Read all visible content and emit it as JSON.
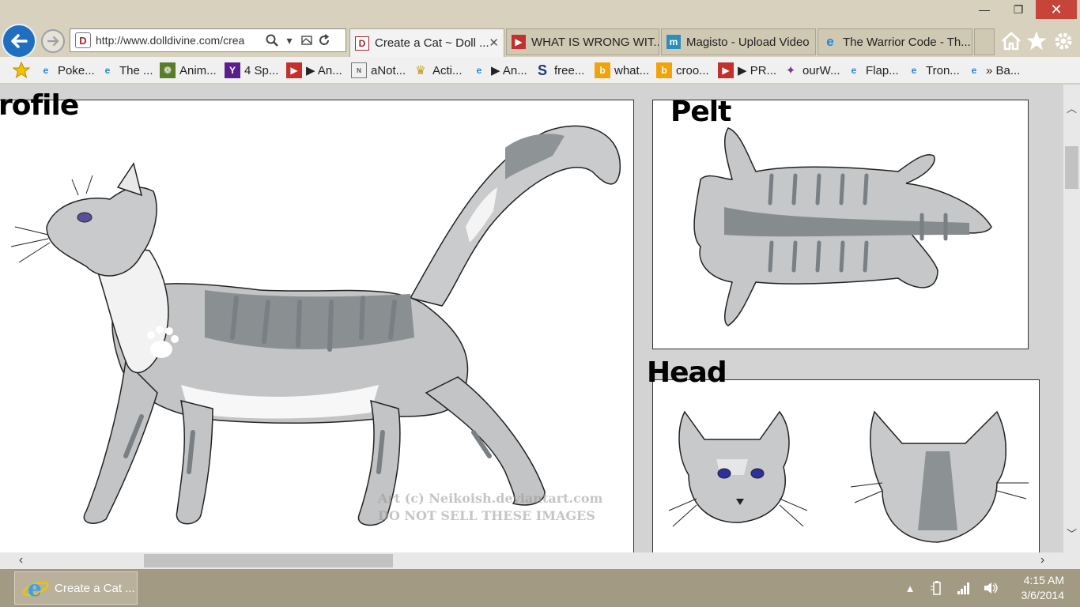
{
  "window": {
    "min_glyph": "—",
    "max_glyph": "❐",
    "close_glyph": "✕"
  },
  "address": {
    "url": "http://www.dolldivine.com/crea"
  },
  "tabs": [
    {
      "label": "Create a Cat ~ Doll ...",
      "icon": "dolldivine-icon",
      "color": "#a0282f",
      "active": true
    },
    {
      "label": "WHAT IS WRONG WIT...",
      "icon": "youtube-icon",
      "color": "#c4302b",
      "active": false
    },
    {
      "label": "Magisto - Upload Video",
      "icon": "magisto-icon",
      "color": "#2c8fb7",
      "active": false
    },
    {
      "label": "The Warrior Code - Th...",
      "icon": "ie-icon",
      "color": "#1e88d8",
      "active": false
    }
  ],
  "toolbar": {
    "home_icon": "home-icon",
    "favorites_icon": "star-icon",
    "settings_icon": "gear-icon"
  },
  "favorites": [
    {
      "label": "Poke...",
      "icon": "ie-icon",
      "color": "#1e88d8"
    },
    {
      "label": "The ...",
      "icon": "ie-icon",
      "color": "#1e88d8"
    },
    {
      "label": "Anim...",
      "icon": "paw-icon",
      "color": "#5a7d2a"
    },
    {
      "label": "4 Sp...",
      "icon": "yahoo-icon",
      "color": "#5b1f8c"
    },
    {
      "label": "▶ An...",
      "icon": "youtube-icon",
      "color": "#c4302b"
    },
    {
      "label": "aNot...",
      "icon": "notepad-icon",
      "color": "#777777"
    },
    {
      "label": "Acti...",
      "icon": "crown-icon",
      "color": "#c79a1a"
    },
    {
      "label": "▶ An...",
      "icon": "ie-icon",
      "color": "#1e88d8"
    },
    {
      "label": "free...",
      "icon": "s-icon",
      "color": "#1c3a6b"
    },
    {
      "label": "what...",
      "icon": "bing-icon",
      "color": "#f0a30a"
    },
    {
      "label": "croo...",
      "icon": "bing-icon",
      "color": "#f0a30a"
    },
    {
      "label": "▶ PR...",
      "icon": "youtube-icon",
      "color": "#c4302b"
    },
    {
      "label": "ourW...",
      "icon": "site-icon",
      "color": "#7a3b8a"
    },
    {
      "label": "Flap...",
      "icon": "ie-icon",
      "color": "#1e88d8"
    },
    {
      "label": "Tron...",
      "icon": "ie-icon",
      "color": "#1e88d8"
    },
    {
      "label": "» Ba...",
      "icon": "ie-icon",
      "color": "#1e88d8"
    }
  ],
  "content": {
    "profile_label": "rofile",
    "pelt_label": "Pelt",
    "head_label": "Head",
    "watermark_line1": "Art (c) Neikoish.deviantart.com",
    "watermark_line2": "DO NOT SELL THESE IMAGES"
  },
  "taskbar": {
    "ie_task_label": "Create a Cat ...",
    "time": "4:15 AM",
    "date": "3/6/2014",
    "tray_arrow": "▲"
  }
}
